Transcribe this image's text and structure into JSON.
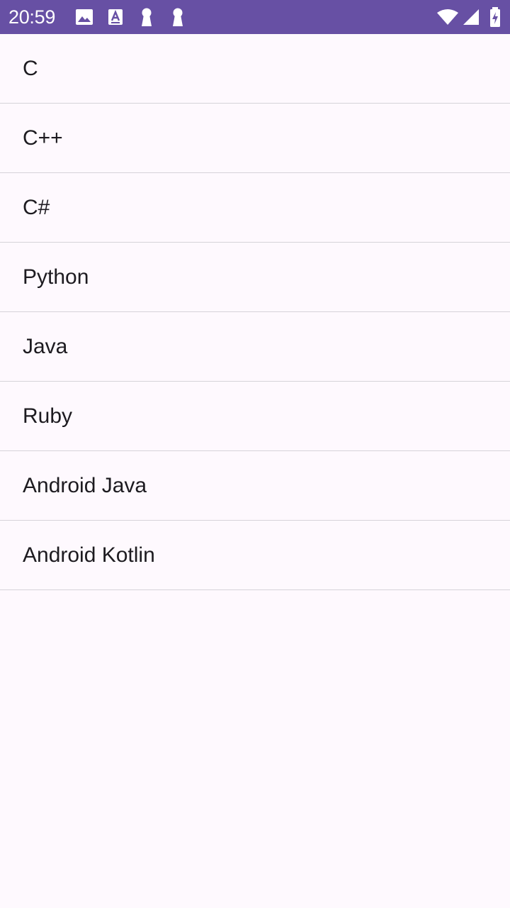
{
  "status_bar": {
    "time": "20:59",
    "background": "#6750a4",
    "icons_left": [
      "image-icon",
      "text-a-icon",
      "keyhole-icon",
      "keyhole-icon"
    ],
    "icons_right": [
      "wifi-icon",
      "cell-signal-icon",
      "battery-charging-icon"
    ]
  },
  "list": {
    "items": [
      {
        "label": "C"
      },
      {
        "label": "C++"
      },
      {
        "label": "C#"
      },
      {
        "label": "Python"
      },
      {
        "label": "Java"
      },
      {
        "label": "Ruby"
      },
      {
        "label": "Android Java"
      },
      {
        "label": "Android Kotlin"
      }
    ]
  }
}
